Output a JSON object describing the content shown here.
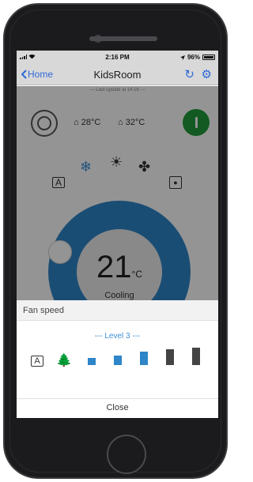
{
  "status": {
    "time": "2:16 PM",
    "battery": "96%"
  },
  "nav": {
    "back_label": "Home",
    "title": "KidsRoom"
  },
  "main": {
    "last_update": "--- Last update at 14:16 ---",
    "indoor_temp": "28°C",
    "outdoor_temp": "32°C",
    "set_temp": "21",
    "unit": "°C",
    "mode": "Cooling"
  },
  "sheet": {
    "title": "Fan speed",
    "level": "--- Level 3 ---",
    "bars": [
      {
        "level": 1,
        "height_fraction": 0.4,
        "active": true,
        "color": "#2e86c8"
      },
      {
        "level": 2,
        "height_fraction": 0.55,
        "active": true,
        "color": "#2e86c8"
      },
      {
        "level": 3,
        "height_fraction": 0.75,
        "active": true,
        "color": "#2e86c8"
      },
      {
        "level": 4,
        "height_fraction": 0.9,
        "active": false,
        "color": "#444444"
      },
      {
        "level": 5,
        "height_fraction": 1.0,
        "active": false,
        "color": "#444444"
      }
    ],
    "close_label": "Close"
  },
  "colors": {
    "accent": "#3478f6",
    "dial": "#2e86c8",
    "on_button": "#1f9b3a"
  }
}
